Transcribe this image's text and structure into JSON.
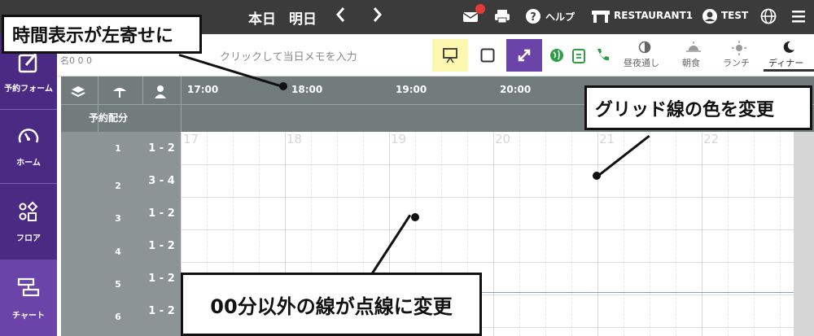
{
  "topbar": {
    "today": "本日",
    "tomorrow": "明日",
    "prev": "‹",
    "next": "›",
    "help": "ヘルプ",
    "restaurant": "RESTAURANT1",
    "user": "TEST"
  },
  "sidebar": {
    "items": [
      {
        "label": "予約フォーム"
      },
      {
        "label": "ホーム"
      },
      {
        "label": "フロア"
      },
      {
        "label": "チャート"
      }
    ]
  },
  "toolbar": {
    "counts": "名0 0 0",
    "memo_placeholder": "クリックして当日メモを入力",
    "modes": [
      {
        "label": "昼夜通し"
      },
      {
        "label": "朝食"
      },
      {
        "label": "ランチ"
      },
      {
        "label": "ディナー"
      }
    ]
  },
  "grid": {
    "times": [
      "17:00",
      "18:00",
      "19:00",
      "20:00"
    ],
    "allocation_label": "予約配分",
    "ghost_hours": [
      "17",
      "18",
      "19",
      "20",
      "21",
      "22"
    ],
    "rows": [
      {
        "table": "1",
        "cap": "1 - 2"
      },
      {
        "table": "2",
        "cap": "3 - 4"
      },
      {
        "table": "3",
        "cap": "1 - 2"
      },
      {
        "table": "4",
        "cap": "1 - 2"
      },
      {
        "table": "5",
        "cap": "1 - 2"
      },
      {
        "table": "6",
        "cap": "1 - 2"
      }
    ]
  },
  "callouts": {
    "time_left": "時間表示が左寄せに",
    "grid_color": "グリッド線の色を変更",
    "dotted_lines": "00分以外の線が点線に変更"
  },
  "colors": {
    "topbar": "#3b3b3b",
    "sidebar": "#4a2a83",
    "header": "#737c7c",
    "accent": "#6a44a8"
  }
}
